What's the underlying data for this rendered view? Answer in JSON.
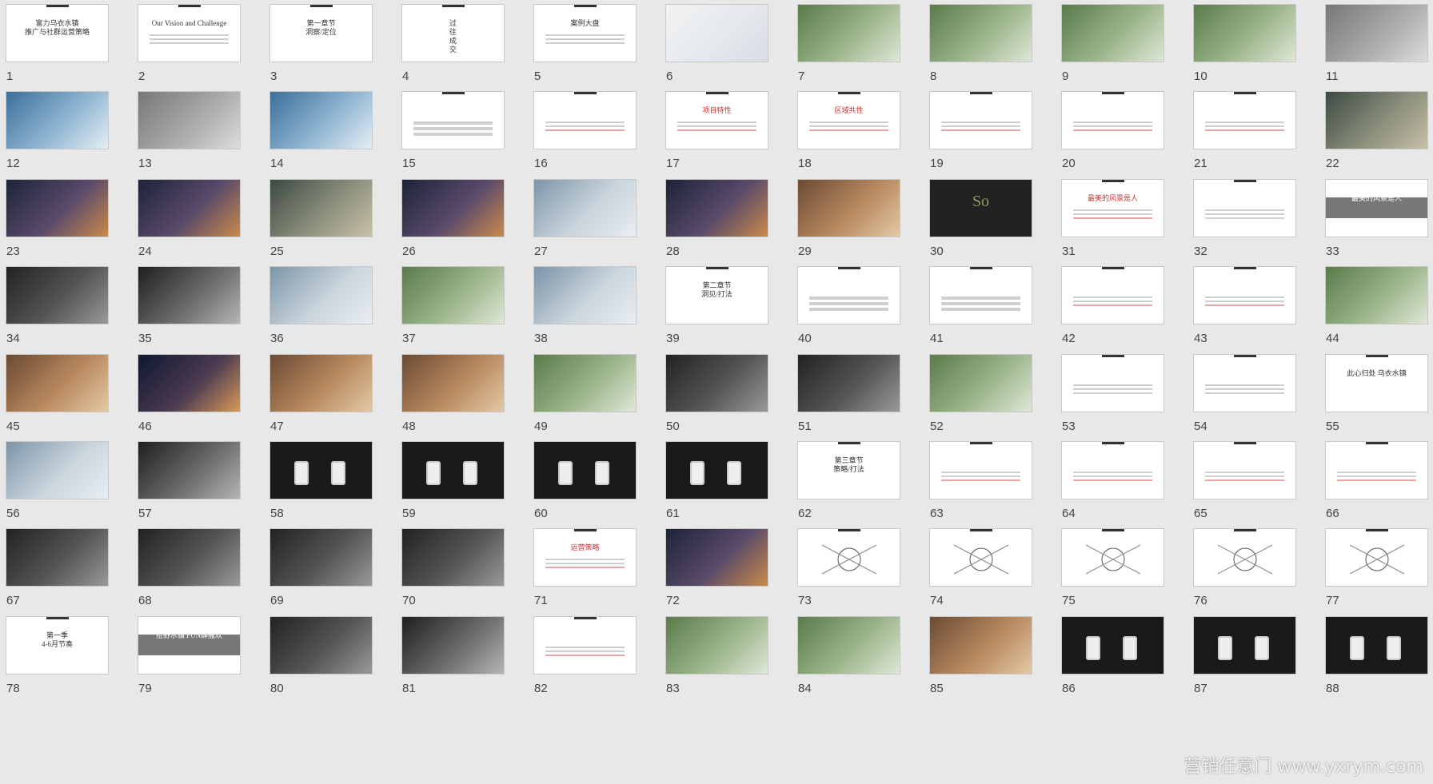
{
  "watermark": "营销任意门 www.yxrym.com",
  "slides": [
    {
      "n": "1",
      "t": "富力乌衣水镇\n推广与社群运营策略",
      "k": "title"
    },
    {
      "n": "2",
      "t": "Our Vision and Challenge",
      "k": "text"
    },
    {
      "n": "3",
      "t": "第一章节\n洞察/定位",
      "k": "title"
    },
    {
      "n": "4",
      "t": "过\n往\n成\n交",
      "k": "title"
    },
    {
      "n": "5",
      "t": "案例大盘",
      "k": "text"
    },
    {
      "n": "6",
      "t": "",
      "k": "map"
    },
    {
      "n": "7",
      "t": "",
      "k": "photo-green"
    },
    {
      "n": "8",
      "t": "",
      "k": "photo-green"
    },
    {
      "n": "9",
      "t": "",
      "k": "photo-green"
    },
    {
      "n": "10",
      "t": "",
      "k": "photo-green"
    },
    {
      "n": "11",
      "t": "",
      "k": "photo-gray"
    },
    {
      "n": "12",
      "t": "",
      "k": "photo-blue"
    },
    {
      "n": "13",
      "t": "",
      "k": "photo-gray"
    },
    {
      "n": "14",
      "t": "",
      "k": "photo-blue"
    },
    {
      "n": "15",
      "t": "",
      "k": "table"
    },
    {
      "n": "16",
      "t": "",
      "k": "text-red"
    },
    {
      "n": "17",
      "t": "项目特性",
      "k": "text-red"
    },
    {
      "n": "18",
      "t": "区域共性",
      "k": "text-red"
    },
    {
      "n": "19",
      "t": "",
      "k": "text-red"
    },
    {
      "n": "20",
      "t": "",
      "k": "text-red"
    },
    {
      "n": "21",
      "t": "",
      "k": "text-red"
    },
    {
      "n": "22",
      "t": "",
      "k": "photo-aerial"
    },
    {
      "n": "23",
      "t": "",
      "k": "photo-night"
    },
    {
      "n": "24",
      "t": "",
      "k": "photo-night"
    },
    {
      "n": "25",
      "t": "",
      "k": "photo-aerial"
    },
    {
      "n": "26",
      "t": "",
      "k": "photo-night"
    },
    {
      "n": "27",
      "t": "",
      "k": "photo-sky"
    },
    {
      "n": "28",
      "t": "",
      "k": "photo-night"
    },
    {
      "n": "29",
      "t": "",
      "k": "photo-warm"
    },
    {
      "n": "30",
      "t": "So",
      "k": "so"
    },
    {
      "n": "31",
      "t": "最美的风景是人",
      "k": "text-red"
    },
    {
      "n": "32",
      "t": "",
      "k": "text"
    },
    {
      "n": "33",
      "t": "最美的风景是人",
      "k": "gray"
    },
    {
      "n": "34",
      "t": "",
      "k": "photo-dark"
    },
    {
      "n": "35",
      "t": "",
      "k": "photo-mono"
    },
    {
      "n": "36",
      "t": "",
      "k": "photo-sky"
    },
    {
      "n": "37",
      "t": "",
      "k": "photo-green"
    },
    {
      "n": "38",
      "t": "",
      "k": "photo-sky"
    },
    {
      "n": "39",
      "t": "第二章节\n洞见/打法",
      "k": "title"
    },
    {
      "n": "40",
      "t": "",
      "k": "table"
    },
    {
      "n": "41",
      "t": "",
      "k": "table"
    },
    {
      "n": "42",
      "t": "",
      "k": "text-red"
    },
    {
      "n": "43",
      "t": "",
      "k": "text-red"
    },
    {
      "n": "44",
      "t": "",
      "k": "photo-green"
    },
    {
      "n": "45",
      "t": "",
      "k": "photo-warm"
    },
    {
      "n": "46",
      "t": "",
      "k": "photo-dusk"
    },
    {
      "n": "47",
      "t": "",
      "k": "photo-warm"
    },
    {
      "n": "48",
      "t": "",
      "k": "photo-warm"
    },
    {
      "n": "49",
      "t": "",
      "k": "photo-green"
    },
    {
      "n": "50",
      "t": "",
      "k": "photo-dark"
    },
    {
      "n": "51",
      "t": "",
      "k": "photo-dark"
    },
    {
      "n": "52",
      "t": "",
      "k": "photo-green"
    },
    {
      "n": "53",
      "t": "",
      "k": "text"
    },
    {
      "n": "54",
      "t": "",
      "k": "text"
    },
    {
      "n": "55",
      "t": "此心归处 乌衣水镇",
      "k": "title"
    },
    {
      "n": "56",
      "t": "",
      "k": "photo-sky"
    },
    {
      "n": "57",
      "t": "",
      "k": "photo-mono"
    },
    {
      "n": "58",
      "t": "",
      "k": "phone-dark"
    },
    {
      "n": "59",
      "t": "",
      "k": "phone-dark"
    },
    {
      "n": "60",
      "t": "",
      "k": "phone-dark"
    },
    {
      "n": "61",
      "t": "",
      "k": "phone-dark"
    },
    {
      "n": "62",
      "t": "第三章节\n策略/打法",
      "k": "title"
    },
    {
      "n": "63",
      "t": "",
      "k": "text-red"
    },
    {
      "n": "64",
      "t": "",
      "k": "text-red"
    },
    {
      "n": "65",
      "t": "",
      "k": "text-red"
    },
    {
      "n": "66",
      "t": "",
      "k": "text-red"
    },
    {
      "n": "67",
      "t": "",
      "k": "photo-dark"
    },
    {
      "n": "68",
      "t": "",
      "k": "photo-dark"
    },
    {
      "n": "69",
      "t": "",
      "k": "photo-dark"
    },
    {
      "n": "70",
      "t": "",
      "k": "photo-dark"
    },
    {
      "n": "71",
      "t": "运营策略",
      "k": "text-red"
    },
    {
      "n": "72",
      "t": "",
      "k": "photo-night"
    },
    {
      "n": "73",
      "t": "",
      "k": "diagram"
    },
    {
      "n": "74",
      "t": "",
      "k": "diagram"
    },
    {
      "n": "75",
      "t": "",
      "k": "diagram"
    },
    {
      "n": "76",
      "t": "",
      "k": "diagram"
    },
    {
      "n": "77",
      "t": "",
      "k": "diagram"
    },
    {
      "n": "78",
      "t": "第一季\n4-6月节奏",
      "k": "title"
    },
    {
      "n": "79",
      "t": "拾野水镇 FUN肆撒欢",
      "k": "gray"
    },
    {
      "n": "80",
      "t": "",
      "k": "photo-dark"
    },
    {
      "n": "81",
      "t": "",
      "k": "photo-mono"
    },
    {
      "n": "82",
      "t": "",
      "k": "text-red"
    },
    {
      "n": "83",
      "t": "",
      "k": "photo-green"
    },
    {
      "n": "84",
      "t": "",
      "k": "photo-green"
    },
    {
      "n": "85",
      "t": "",
      "k": "photo-warm"
    },
    {
      "n": "86",
      "t": "",
      "k": "phone-dark"
    },
    {
      "n": "87",
      "t": "",
      "k": "phone-dark"
    },
    {
      "n": "88",
      "t": "",
      "k": "phone-dark"
    }
  ]
}
